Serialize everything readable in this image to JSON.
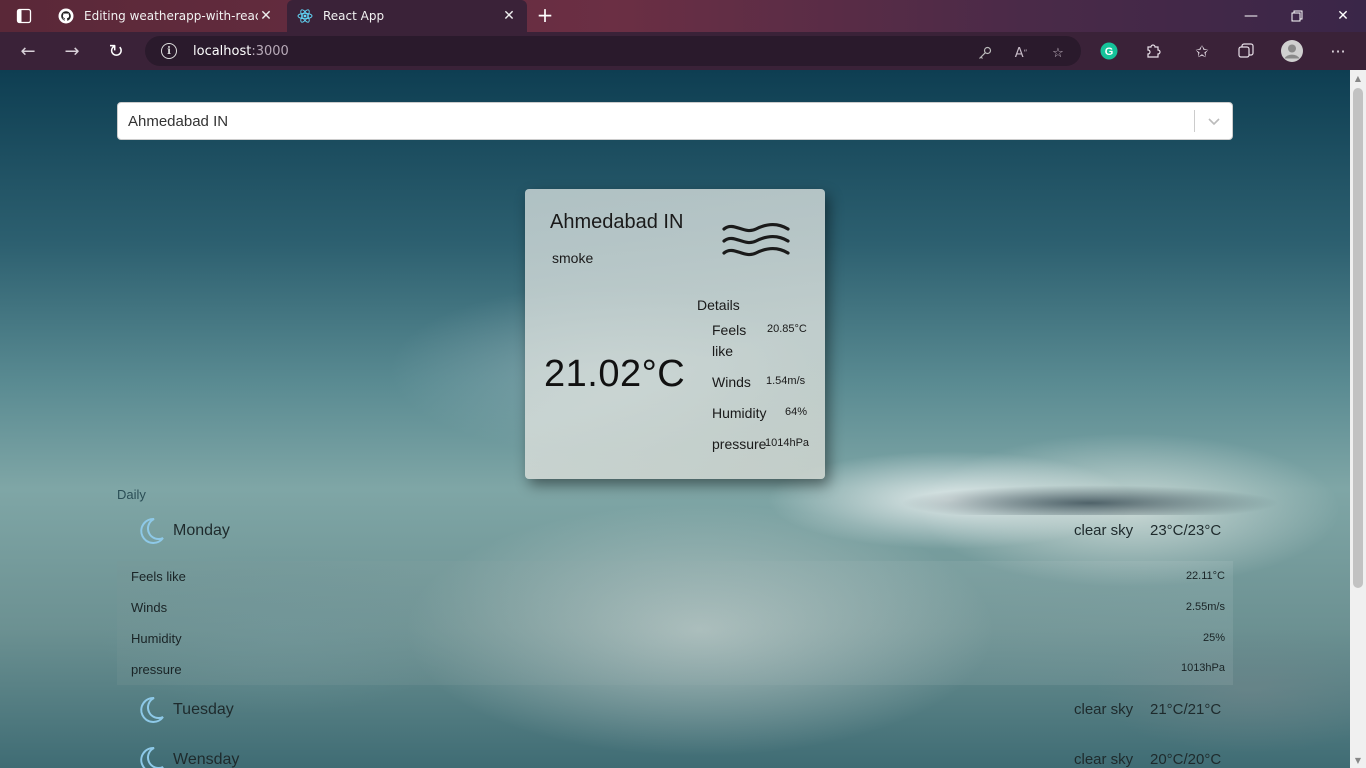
{
  "browser": {
    "tabs": [
      {
        "title": "Editing weatherapp-with-reactjs/",
        "icon": "github-icon"
      },
      {
        "title": "React App",
        "icon": "react-icon"
      }
    ],
    "address": {
      "host": "localhost",
      "port": ":3000"
    }
  },
  "search": {
    "selected": "Ahmedabad IN"
  },
  "current": {
    "city": "Ahmedabad IN",
    "description": "smoke",
    "icon": "smoke-icon",
    "temperature": "21.02°C",
    "details_heading": "Details",
    "details": [
      {
        "label": "Feels like",
        "value": "20.85°C"
      },
      {
        "label": "Winds",
        "value": "1.54m/s"
      },
      {
        "label": "Humidity",
        "value": "64%"
      },
      {
        "label": "pressure",
        "value": "1014hPa"
      }
    ]
  },
  "daily": {
    "heading": "Daily",
    "days": [
      {
        "name": "Monday",
        "sky": "clear sky",
        "range": "23°C/23°C",
        "icon": "moon-icon"
      },
      {
        "name": "Tuesday",
        "sky": "clear sky",
        "range": "21°C/21°C",
        "icon": "moon-icon"
      },
      {
        "name": "Wensday",
        "sky": "clear sky",
        "range": "20°C/20°C",
        "icon": "moon-icon"
      }
    ],
    "expanded_details": [
      {
        "label": "Feels like",
        "value": "22.11°C"
      },
      {
        "label": "Winds",
        "value": "2.55m/s"
      },
      {
        "label": "Humidity",
        "value": "25%"
      },
      {
        "label": "pressure",
        "value": "1013hPa"
      }
    ]
  }
}
